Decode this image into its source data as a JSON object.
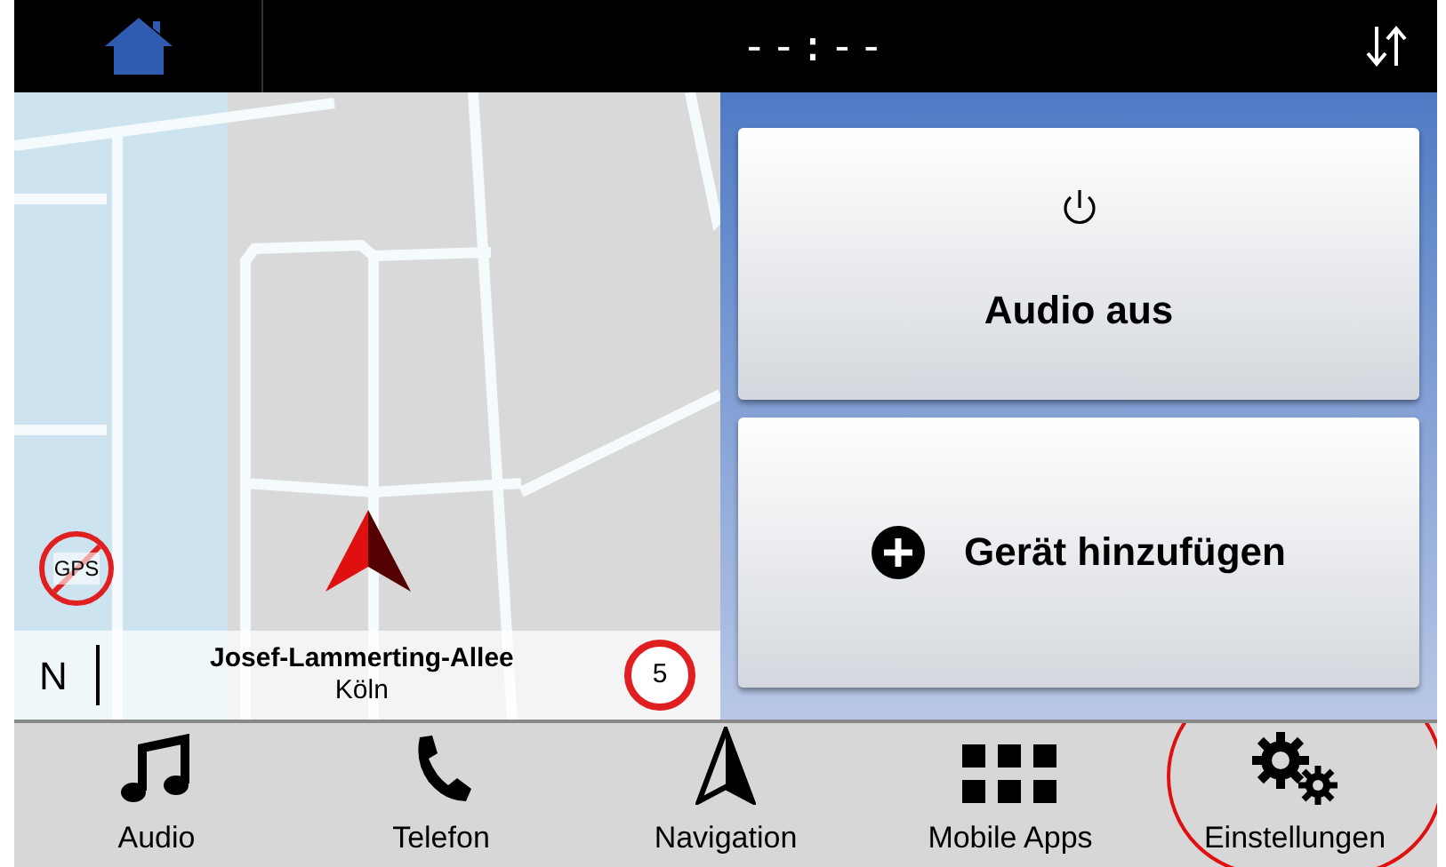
{
  "status_bar": {
    "clock": "--:--"
  },
  "map": {
    "north_label": "N",
    "street": "Josef-Lammerting-Allee",
    "city": "Köln",
    "speed_limit": "5",
    "gps_label": "GPS",
    "gps_available": false
  },
  "actions": [
    {
      "kind": "power",
      "label": "Audio aus"
    },
    {
      "kind": "add",
      "label": "Gerät hinzufügen"
    }
  ],
  "nav": [
    {
      "kind": "audio",
      "label": "Audio",
      "highlighted": false
    },
    {
      "kind": "phone",
      "label": "Telefon",
      "highlighted": false
    },
    {
      "kind": "navigation",
      "label": "Navigation",
      "highlighted": false
    },
    {
      "kind": "apps",
      "label": "Mobile Apps",
      "highlighted": false
    },
    {
      "kind": "settings",
      "label": "Einstellungen",
      "highlighted": true
    }
  ]
}
